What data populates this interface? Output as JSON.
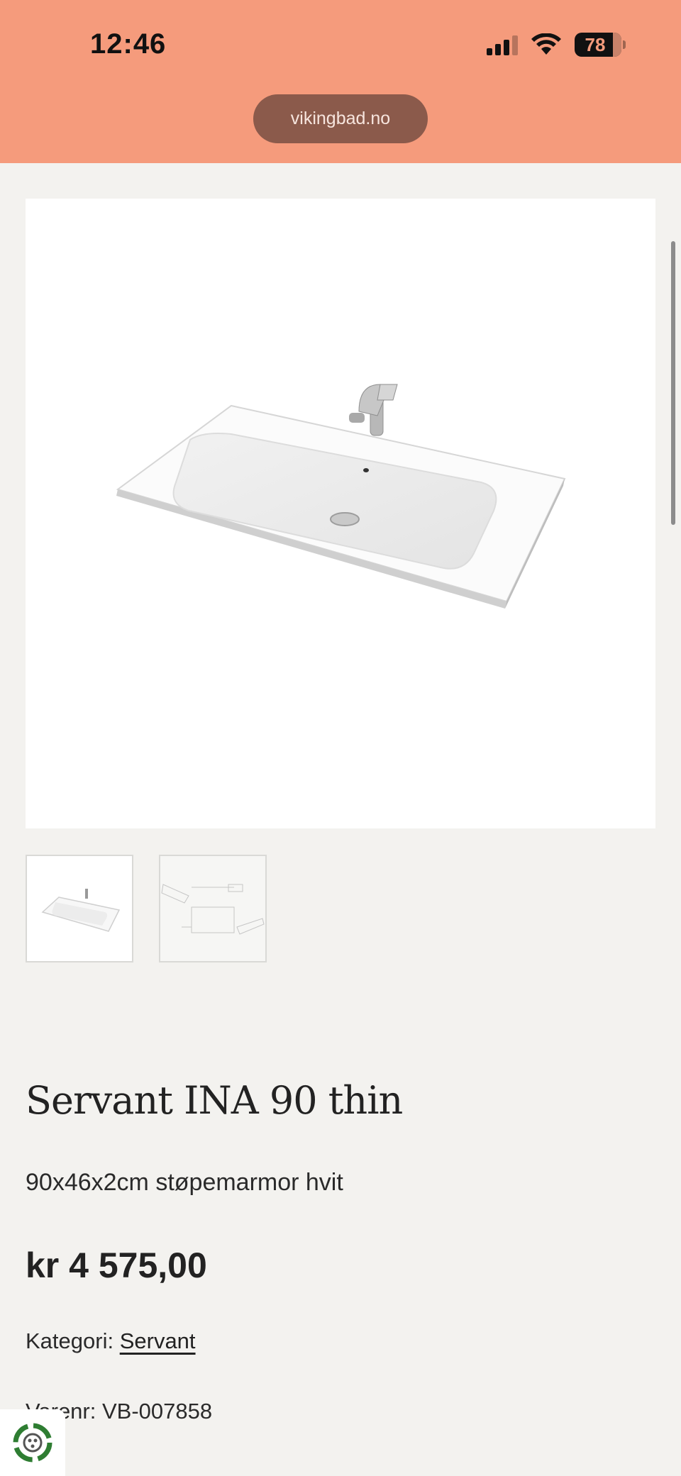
{
  "status_bar": {
    "time": "12:46",
    "battery": "78"
  },
  "browser": {
    "url": "vikingbad.no"
  },
  "product": {
    "title": "Servant INA 90 thin",
    "subtitle": "90x46x2cm støpemarmor hvit",
    "price": "kr 4 575,00",
    "category_label": "Kategori:",
    "category_link": "Servant",
    "sku": "Varenr: VB-007858"
  },
  "gallery": {
    "thumbnails": [
      "sink-photo-thumbnail",
      "technical-drawing-thumbnail"
    ]
  },
  "colors": {
    "topbar": "#f59b7c",
    "background": "#f3f2ef",
    "url_pill": "#8b5a4b",
    "eco_green": "#2e7d32"
  }
}
